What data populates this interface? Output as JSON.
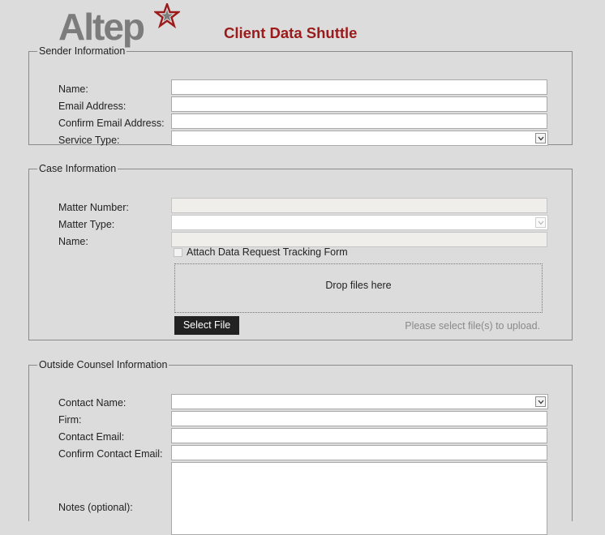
{
  "header": {
    "logo_text": "Altep",
    "app_title": "Client Data Shuttle"
  },
  "colors": {
    "accent": "#9b1b1b",
    "logo_gray": "#7c7c7c",
    "background": "#dcdcdc",
    "button_bg": "#222222"
  },
  "sender": {
    "legend": "Sender Information",
    "name_label": "Name:",
    "name_value": "",
    "email_label": "Email Address:",
    "email_value": "",
    "confirm_email_label": "Confirm Email Address:",
    "confirm_email_value": "",
    "service_type_label": "Service Type:",
    "service_type_value": ""
  },
  "case": {
    "legend": "Case Information",
    "matter_number_label": "Matter Number:",
    "matter_type_label": "Matter Type:",
    "name_label": "Name:",
    "attach_label": "Attach Data Request Tracking Form",
    "dropzone_text": "Drop files here",
    "select_file_label": "Select File",
    "upload_hint": "Please select file(s) to upload."
  },
  "counsel": {
    "legend": "Outside Counsel Information",
    "contact_name_label": "Contact Name:",
    "firm_label": "Firm:",
    "contact_email_label": "Contact Email:",
    "confirm_contact_email_label": "Confirm Contact Email:",
    "notes_label": "Notes (optional):"
  },
  "icons": {
    "logo_star": "star-icon",
    "dropdown": "chevron-down-icon"
  }
}
